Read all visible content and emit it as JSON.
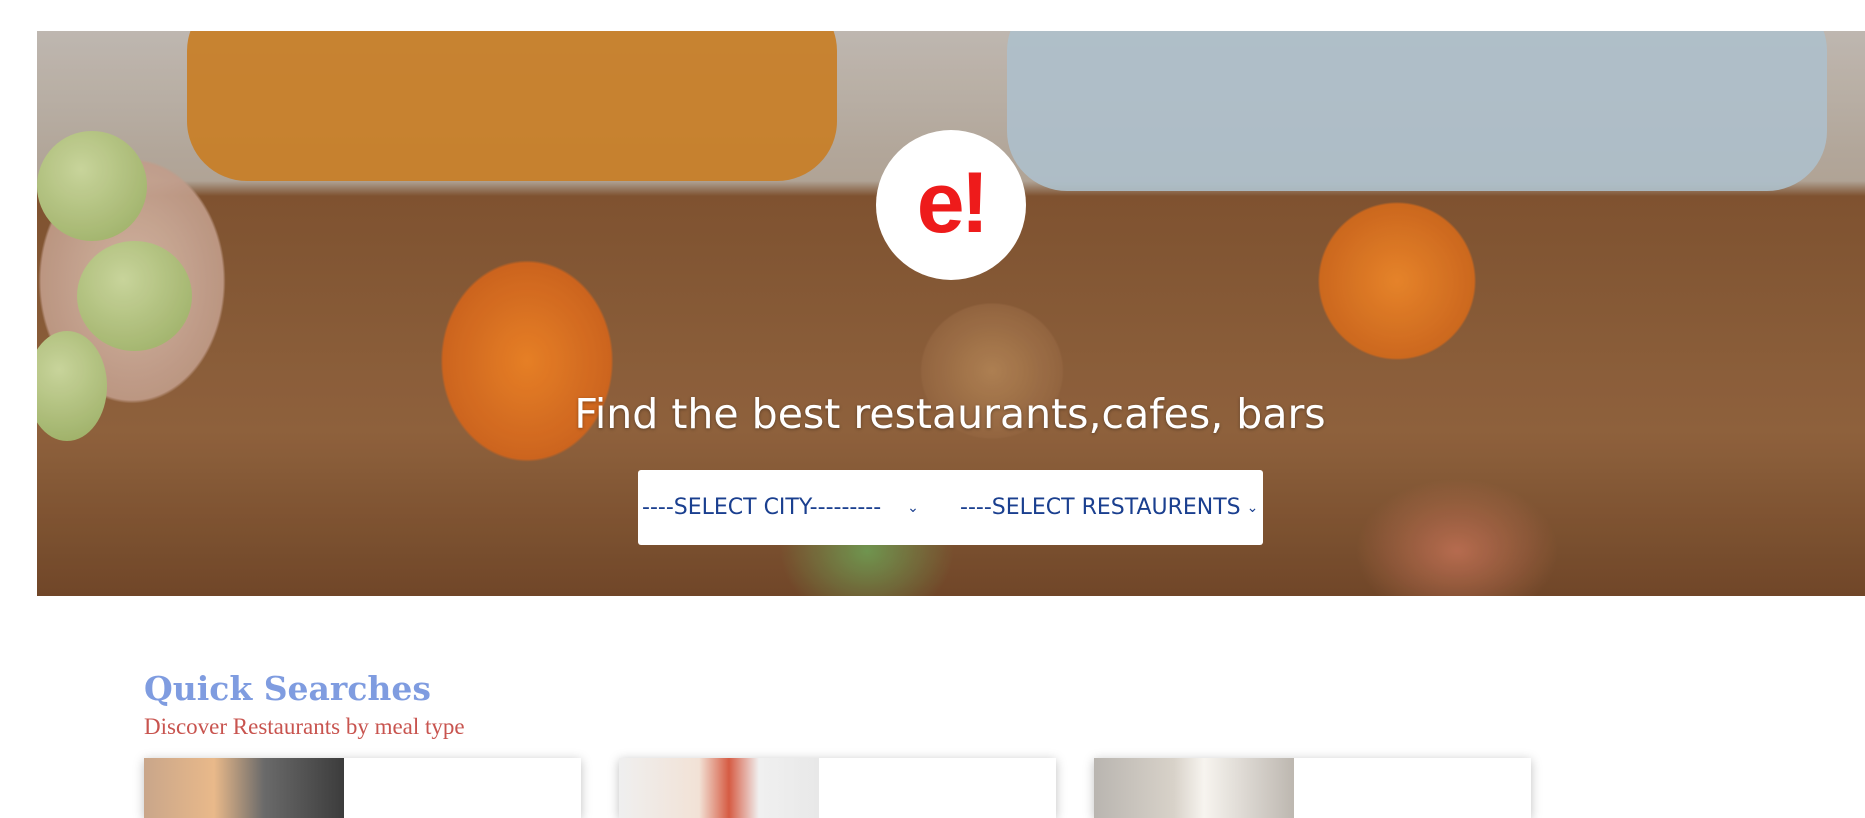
{
  "hero": {
    "logo_text": "e!",
    "tagline": "Find the best restaurants,cafes, bars",
    "city_select": {
      "selected": "----SELECT CITY---------"
    },
    "restaurant_select": {
      "selected": "----SELECT RESTAURENTS"
    }
  },
  "quick_searches": {
    "title": "Quick Searches",
    "subtitle": "Discover Restaurants by meal type",
    "cards": [
      {
        "icon": "breakfast-image"
      },
      {
        "icon": "lunch-image"
      },
      {
        "icon": "snacks-image"
      }
    ]
  },
  "colors": {
    "logo_red": "#ee1b1b",
    "title_blue": "#7f9ce0",
    "subtitle_red": "#c8544f",
    "select_text": "#1a3f8f"
  }
}
